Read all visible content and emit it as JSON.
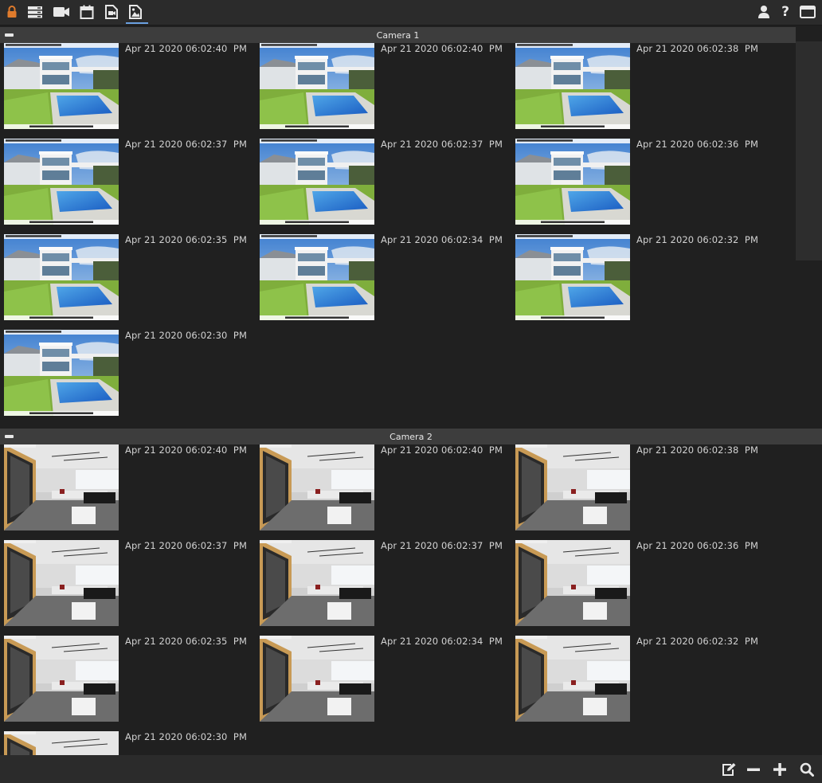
{
  "toolbar": {
    "icons": [
      "lock-icon",
      "server-icon",
      "video-camera-icon",
      "calendar-icon",
      "playback-file-icon",
      "image-gallery-icon"
    ],
    "right_icons": [
      "user-icon",
      "help-icon",
      "window-icon"
    ],
    "help_label": "?",
    "colors": {
      "lock": "#e07b2c",
      "icon": "#e8e8e8",
      "active_underline": "#6aa0e0"
    }
  },
  "sections": [
    {
      "title": "Camera 1",
      "thumb_kind": "house-pool",
      "overlay_top": "FPS: 10.00 21/04/2020 6:02:40 PM",
      "overlay_bottom": "https://www.ispyconnect.com/",
      "items": [
        "Apr 21 2020 06:02:40  PM",
        "Apr 21 2020 06:02:40  PM",
        "Apr 21 2020 06:02:38  PM",
        "Apr 21 2020 06:02:37  PM",
        "Apr 21 2020 06:02:37  PM",
        "Apr 21 2020 06:02:36  PM",
        "Apr 21 2020 06:02:35  PM",
        "Apr 21 2020 06:02:34  PM",
        "Apr 21 2020 06:02:32  PM",
        "Apr 21 2020 06:02:30  PM"
      ]
    },
    {
      "title": "Camera 2",
      "thumb_kind": "office",
      "items": [
        "Apr 21 2020 06:02:40  PM",
        "Apr 21 2020 06:02:40  PM",
        "Apr 21 2020 06:02:38  PM",
        "Apr 21 2020 06:02:37  PM",
        "Apr 21 2020 06:02:37  PM",
        "Apr 21 2020 06:02:36  PM",
        "Apr 21 2020 06:02:35  PM",
        "Apr 21 2020 06:02:34  PM",
        "Apr 21 2020 06:02:32  PM",
        "Apr 21 2020 06:02:30  PM"
      ]
    }
  ],
  "bottom_toolbar": {
    "icons": [
      "edit-icon",
      "zoom-out-icon",
      "zoom-in-icon",
      "search-icon"
    ]
  }
}
